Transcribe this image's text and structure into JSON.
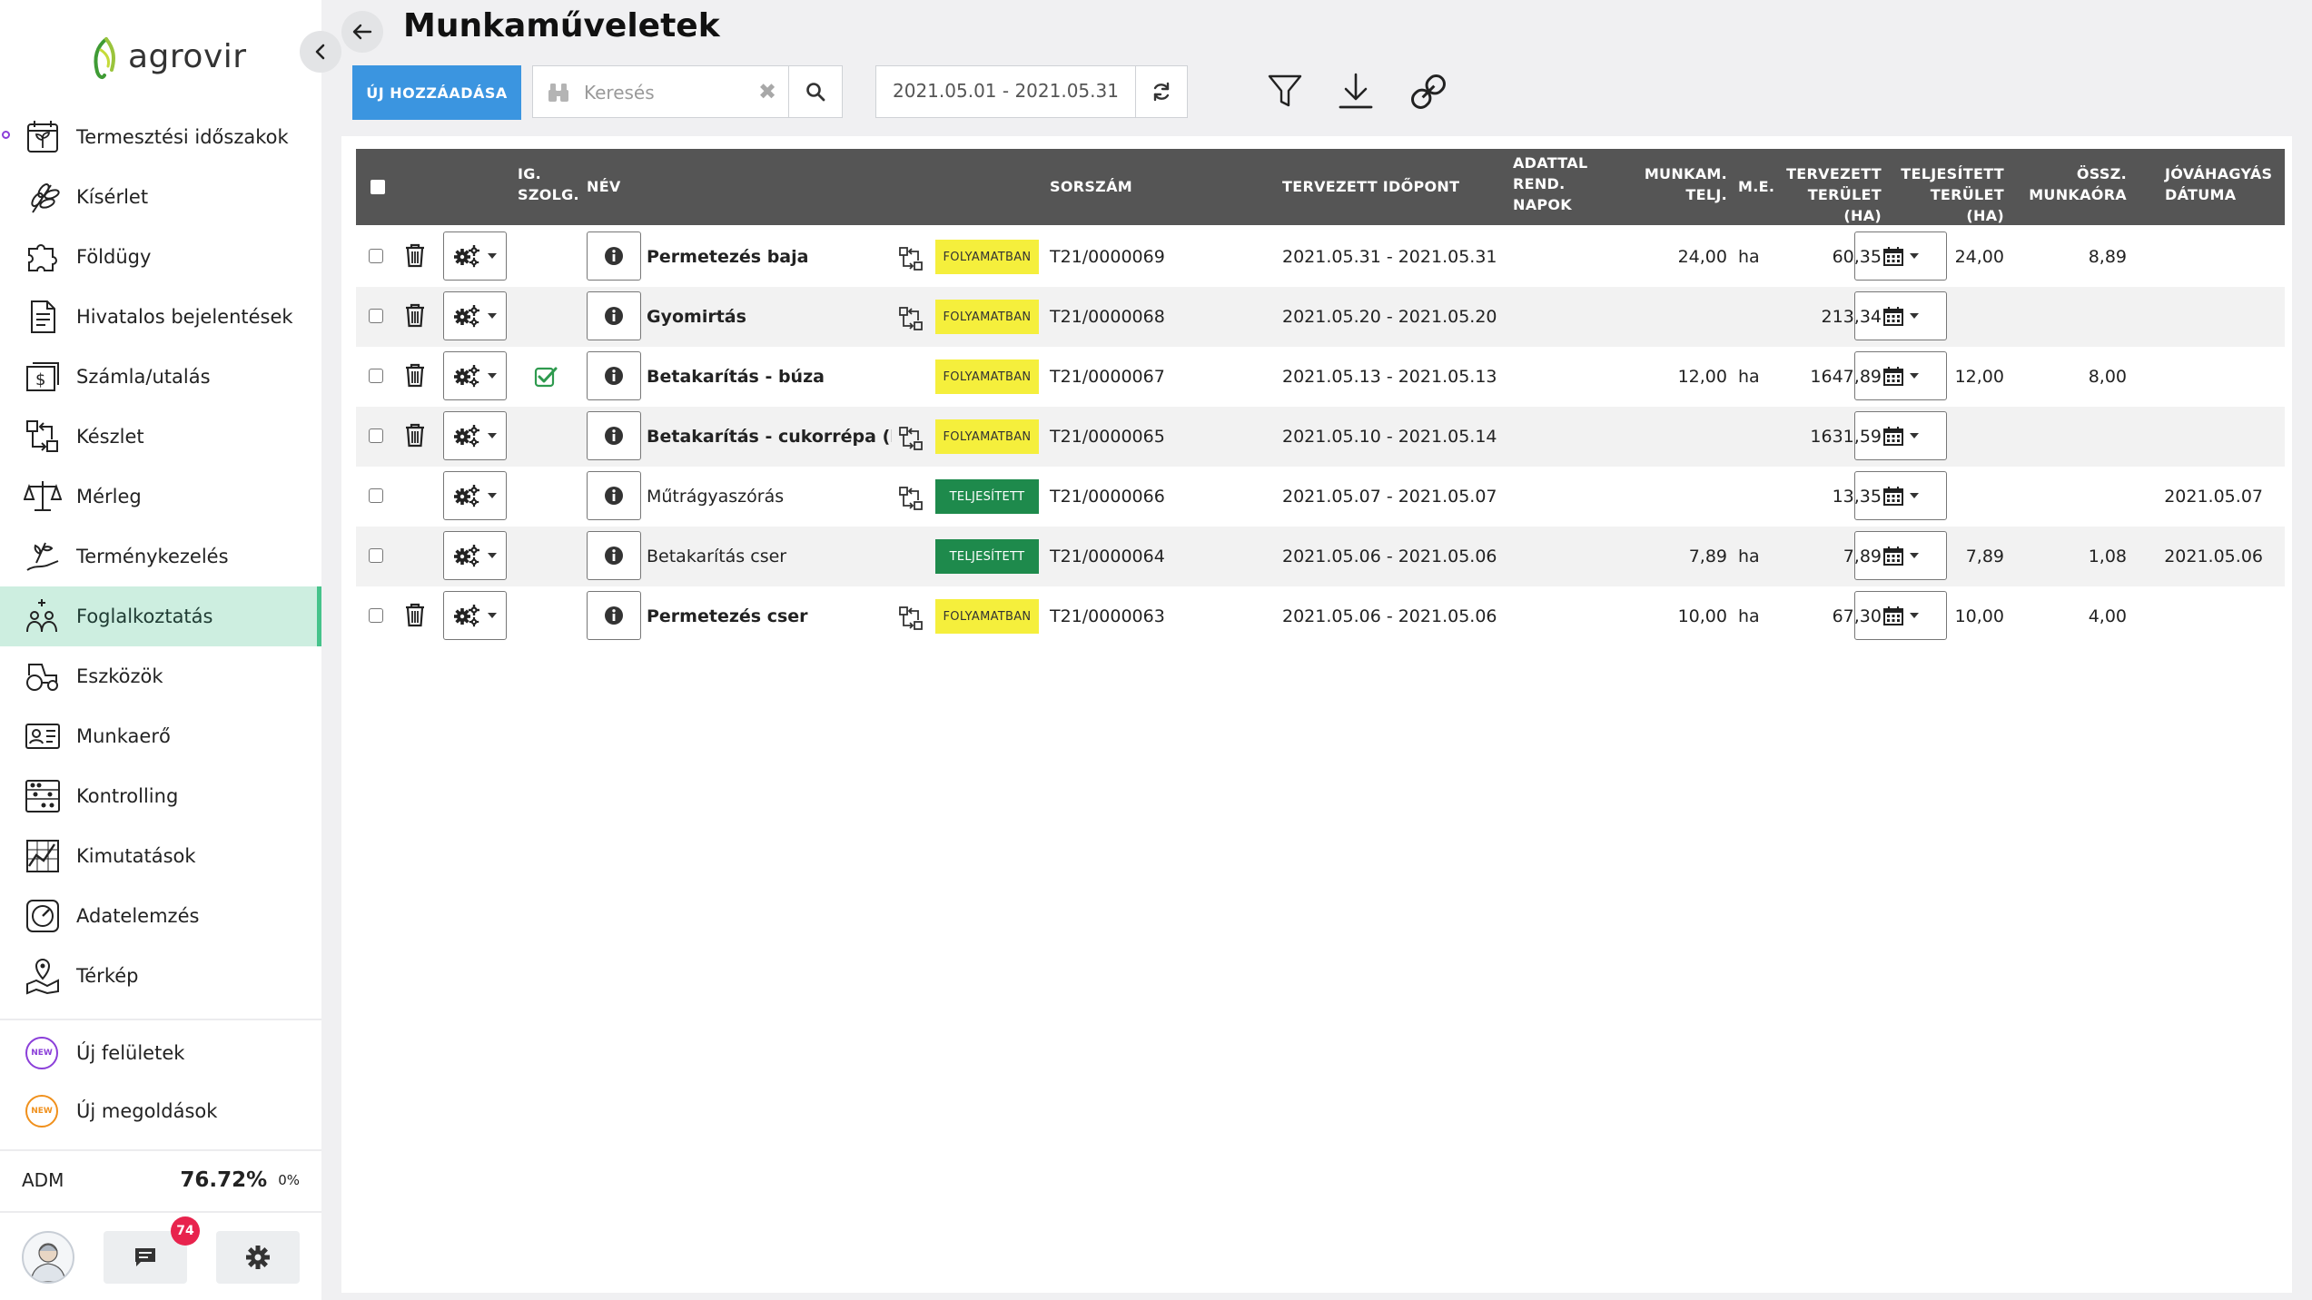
{
  "app": {
    "brand": "agrovir",
    "title": "Munkaműveletek"
  },
  "colors": {
    "accent": "#3b95e0",
    "active_nav": "#cdeee0",
    "status_in_progress": "#f5ef3c",
    "status_done": "#1e8a4c",
    "header_bg": "#555555"
  },
  "sidebar": {
    "items": [
      {
        "label": "Termesztési időszakok",
        "icon": "seedling-calendar-icon"
      },
      {
        "label": "Kísérlet",
        "icon": "wheat-icon"
      },
      {
        "label": "Földügy",
        "icon": "puzzle-icon"
      },
      {
        "label": "Hivatalos bejelentések",
        "icon": "document-icon"
      },
      {
        "label": "Számla/utalás",
        "icon": "invoice-icon"
      },
      {
        "label": "Készlet",
        "icon": "stock-icon"
      },
      {
        "label": "Mérleg",
        "icon": "scale-icon"
      },
      {
        "label": "Terménykezelés",
        "icon": "crop-handling-icon"
      },
      {
        "label": "Foglalkoztatás",
        "icon": "employment-icon"
      },
      {
        "label": "Eszközök",
        "icon": "tractor-icon"
      },
      {
        "label": "Munkaerő",
        "icon": "id-card-icon"
      },
      {
        "label": "Kontrolling",
        "icon": "abacus-icon"
      },
      {
        "label": "Kimutatások",
        "icon": "report-chart-icon"
      },
      {
        "label": "Adatelemzés",
        "icon": "analytics-icon"
      },
      {
        "label": "Térkép",
        "icon": "map-pin-icon"
      }
    ],
    "active": "Foglalkoztatás",
    "new_items": [
      {
        "label": "Új felületek",
        "badge": "NEW",
        "color": "#8b3fd9"
      },
      {
        "label": "Új megoldások",
        "badge": "NEW",
        "color": "#f0901c"
      }
    ],
    "user": {
      "role": "ADM",
      "percent": "76.72%",
      "percent_small": "0%"
    },
    "messages_count": "74"
  },
  "toolbar": {
    "new_button": "ÚJ HOZZÁADÁSA",
    "search_placeholder": "Keresés",
    "search_value": "",
    "date_range": "2021.05.01 - 2021.05.31"
  },
  "table": {
    "headers": {
      "ig_szolg_1": "IG.",
      "ig_szolg_2": "SZOLG.",
      "nev": "NÉV",
      "sorszam": "SORSZÁM",
      "tervezett_idopont": "TERVEZETT IDŐPONT",
      "adattal_1": "ADATTAL",
      "adattal_2": "REND.",
      "adattal_3": "NAPOK",
      "munkam_1": "MUNKAM.",
      "munkam_2": "TELJ.",
      "me": "M.E.",
      "tervezett_terulet_1": "TERVEZETT",
      "tervezett_terulet_2": "TERÜLET (HA)",
      "teljesitett_terulet_1": "TELJESÍTETT",
      "teljesitett_terulet_2": "TERÜLET (HA)",
      "ossz_1": "ÖSSZ.",
      "ossz_2": "MUNKAÓRA",
      "jovahagyas_1": "JÓVÁHAGYÁS",
      "jovahagyas_2": "DÁTUMA"
    },
    "rows": [
      {
        "name": "Permetezés baja",
        "bold": true,
        "trash": true,
        "approved": false,
        "flow": true,
        "status": "FOLYAMATBAN",
        "status_type": "prog",
        "sorszam": "T21/0000069",
        "idopont": "2021.05.31 - 2021.05.31",
        "munkam": "24,00",
        "me": "ha",
        "terv": "60,35",
        "telj": "24,00",
        "ossz": "8,89",
        "jovahagyas": ""
      },
      {
        "name": "Gyomirtás",
        "bold": true,
        "trash": true,
        "approved": false,
        "flow": true,
        "status": "FOLYAMATBAN",
        "status_type": "prog",
        "sorszam": "T21/0000068",
        "idopont": "2021.05.20 - 2021.05.20",
        "munkam": "",
        "me": "",
        "terv": "213,34",
        "telj": "",
        "ossz": "",
        "jovahagyas": ""
      },
      {
        "name": "Betakarítás - búza",
        "bold": true,
        "trash": true,
        "approved": true,
        "flow": false,
        "status": "FOLYAMATBAN",
        "status_type": "prog",
        "sorszam": "T21/0000067",
        "idopont": "2021.05.13 - 2021.05.13",
        "munkam": "12,00",
        "me": "ha",
        "terv": "1647,89",
        "telj": "12,00",
        "ossz": "8,00",
        "jovahagyas": ""
      },
      {
        "name": "Betakarítás - cukorrépa (két.",
        "bold": true,
        "trash": true,
        "approved": false,
        "flow": true,
        "status": "FOLYAMATBAN",
        "status_type": "prog",
        "sorszam": "T21/0000065",
        "idopont": "2021.05.10 - 2021.05.14",
        "munkam": "",
        "me": "",
        "terv": "1631,59",
        "telj": "",
        "ossz": "",
        "jovahagyas": ""
      },
      {
        "name": "Műtrágyaszórás",
        "bold": false,
        "trash": false,
        "approved": false,
        "flow": true,
        "status": "TELJESÍTETT",
        "status_type": "done",
        "sorszam": "T21/0000066",
        "idopont": "2021.05.07 - 2021.05.07",
        "munkam": "",
        "me": "",
        "terv": "13,35",
        "telj": "",
        "ossz": "",
        "jovahagyas": "2021.05.07"
      },
      {
        "name": "Betakarítás cser",
        "bold": false,
        "trash": false,
        "approved": false,
        "flow": false,
        "status": "TELJESÍTETT",
        "status_type": "done",
        "sorszam": "T21/0000064",
        "idopont": "2021.05.06 - 2021.05.06",
        "munkam": "7,89",
        "me": "ha",
        "terv": "7,89",
        "telj": "7,89",
        "ossz": "1,08",
        "jovahagyas": "2021.05.06"
      },
      {
        "name": "Permetezés cser",
        "bold": true,
        "trash": true,
        "approved": false,
        "flow": true,
        "status": "FOLYAMATBAN",
        "status_type": "prog",
        "sorszam": "T21/0000063",
        "idopont": "2021.05.06 - 2021.05.06",
        "munkam": "10,00",
        "me": "ha",
        "terv": "67,30",
        "telj": "10,00",
        "ossz": "4,00",
        "jovahagyas": ""
      }
    ]
  }
}
